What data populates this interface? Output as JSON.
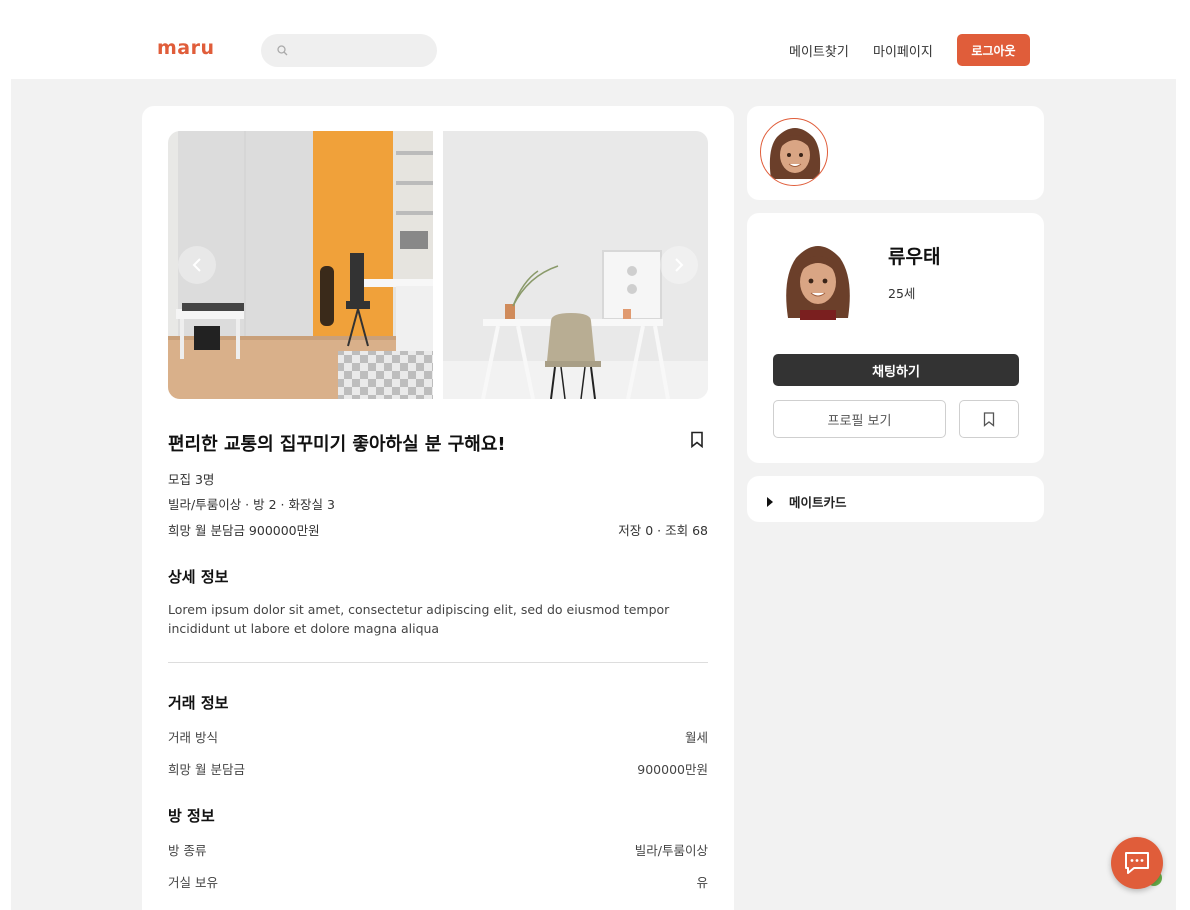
{
  "header": {
    "logo": "maru",
    "search_placeholder": "",
    "nav": [
      "메이트찾기",
      "마이페이지"
    ],
    "logout_label": "로그아웃"
  },
  "post": {
    "title": "편리한 교통의 집꾸미기 좋아하실 분 구해요!",
    "recruit": "모집 3명",
    "room_summary": "빌라/투룸이상 · 방 2 · 화장실 3",
    "budget_summary": "희망 월 분담금 900000만원",
    "stats": "저장 0 · 조회 68",
    "detail_title": "상세 정보",
    "detail_text": "Lorem ipsum dolor sit amet, consectetur adipiscing elit, sed do eiusmod tempor incididunt ut labore et dolore magna aliqua",
    "deal_title": "거래 정보",
    "deal_rows": [
      {
        "label": "거래 방식",
        "value": "월세"
      },
      {
        "label": "희망 월 분담금",
        "value": "900000만원"
      }
    ],
    "room_title": "방 정보",
    "room_rows": [
      {
        "label": "방 종류",
        "value": "빌라/투룸이상"
      },
      {
        "label": "거실 보유",
        "value": "유"
      }
    ]
  },
  "profile": {
    "name": "류우태",
    "age": "25세",
    "chat_label": "채팅하기",
    "profile_label": "프로필 보기",
    "matecard_label": "메이트카드"
  },
  "colors": {
    "accent": "#e05d3a",
    "dark_button": "#333333",
    "page_bg": "#f2f2f2"
  }
}
